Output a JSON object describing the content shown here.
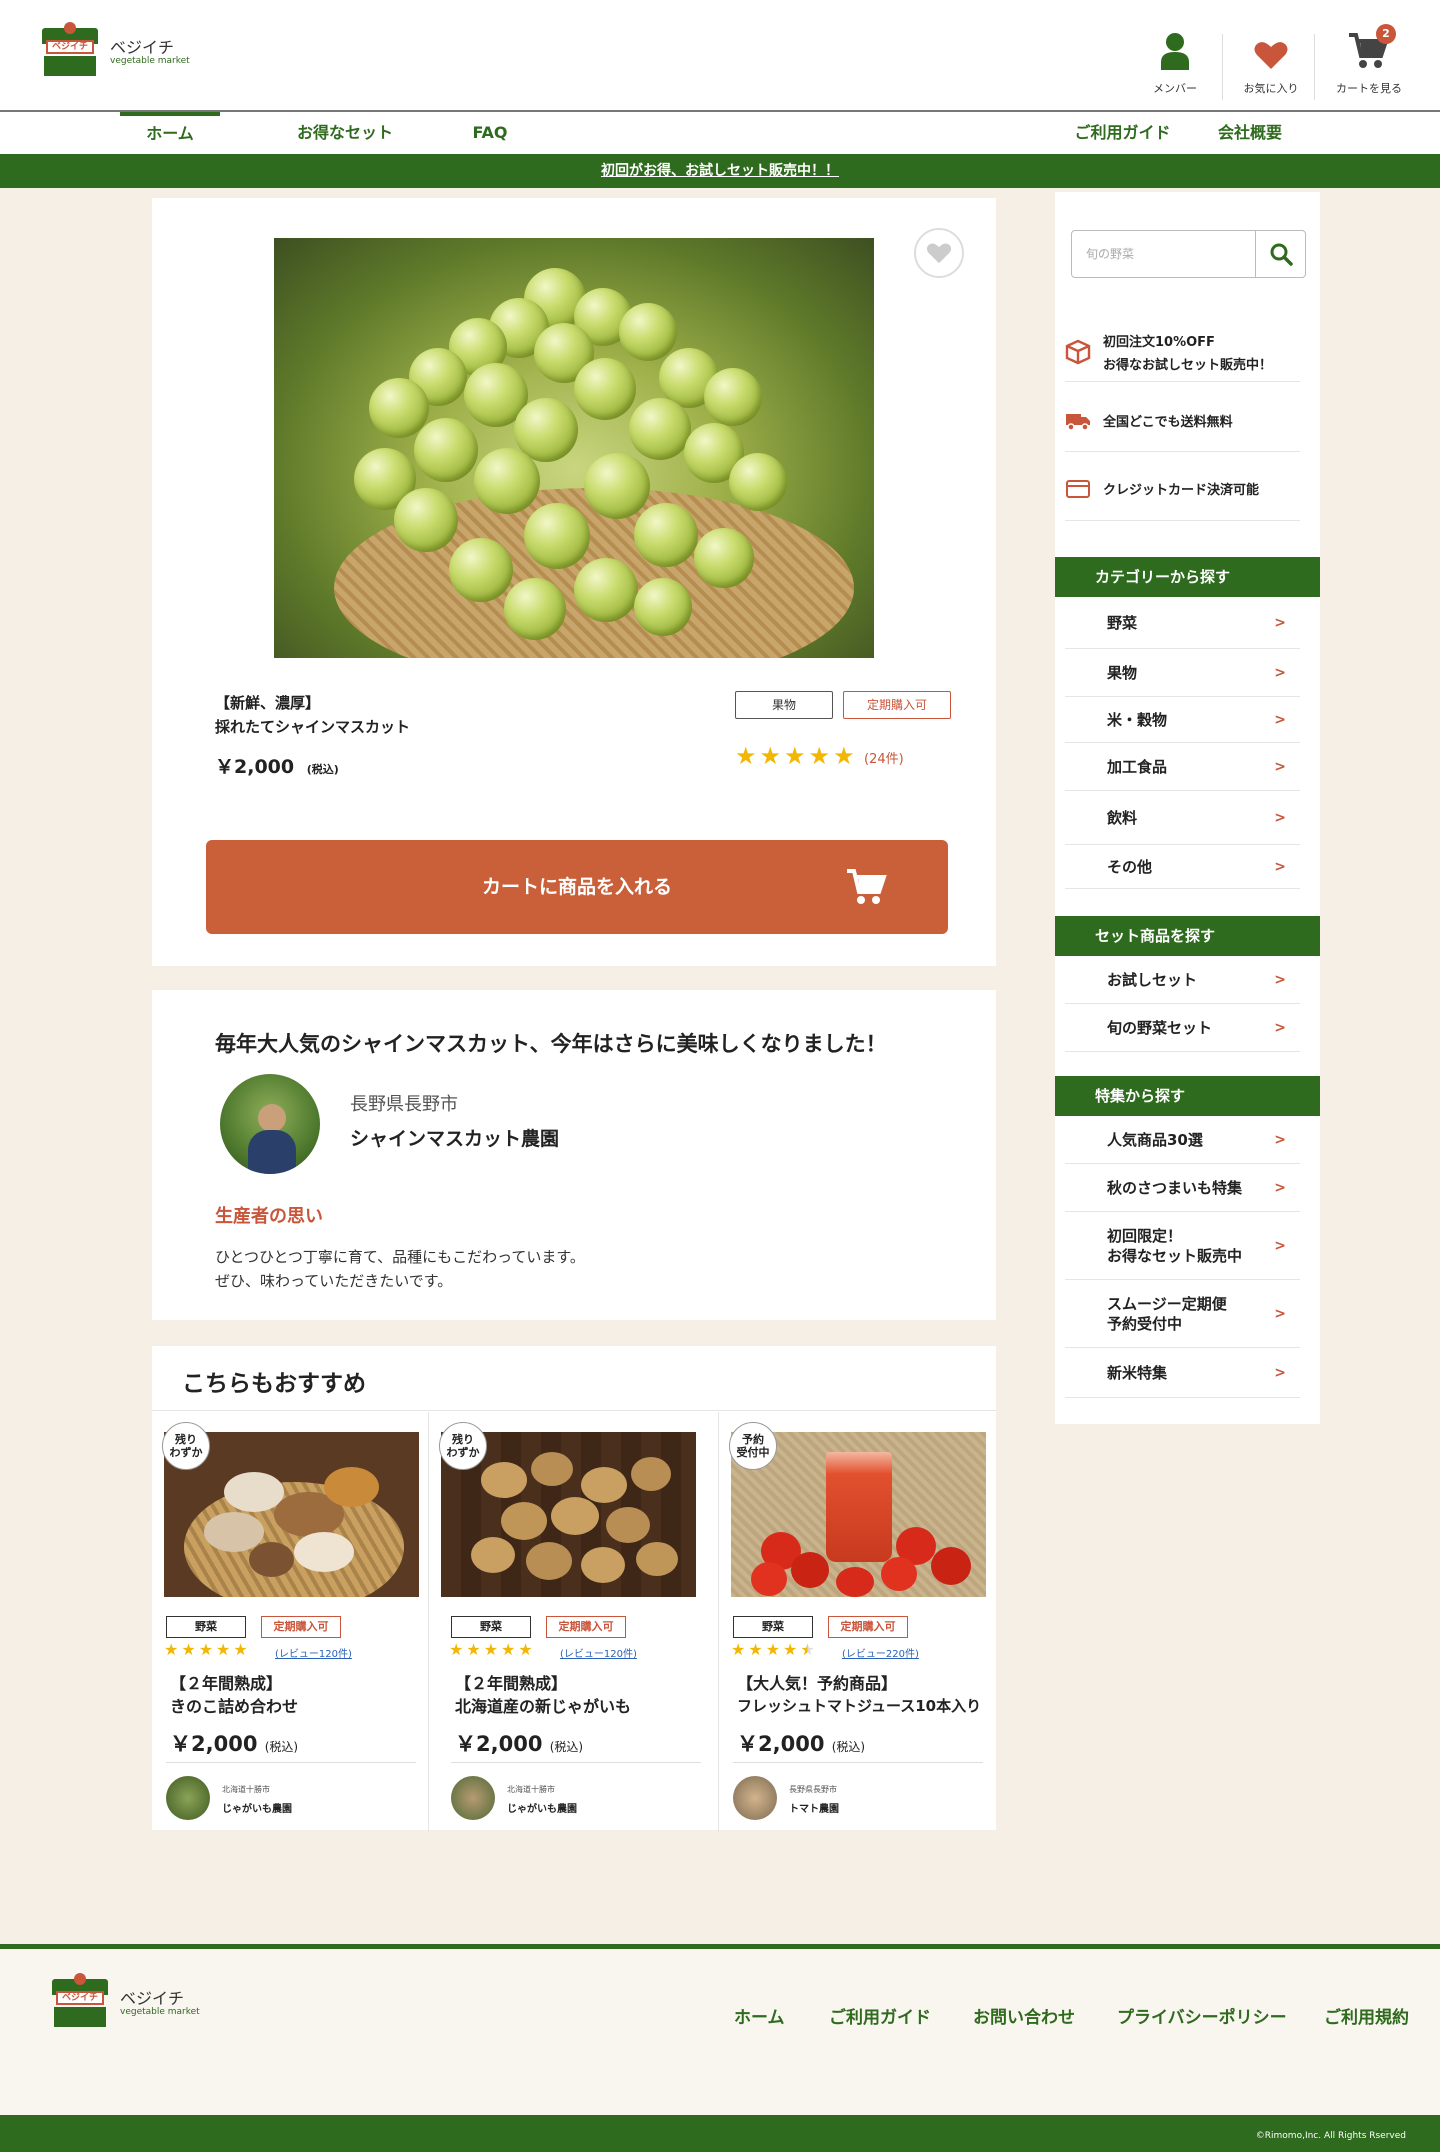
{
  "brand": {
    "name": "ベジイチ",
    "sub": "vegetable market",
    "sign": "ベジイチ"
  },
  "header": {
    "member": "メンバー",
    "favorite": "お気に入り",
    "cart": "カートを見る",
    "cart_count": "2"
  },
  "nav": {
    "items": [
      "ホーム",
      "お得なセット",
      "FAQ"
    ],
    "right": [
      "ご利用ガイド",
      "会社概要"
    ]
  },
  "banner": "初回がお得、お試しセット販売中！！",
  "product": {
    "title_line1": "【新鮮、濃厚】",
    "title_line2": "採れたてシャインマスカット",
    "price": "￥2,000",
    "tax": "(税込)",
    "tag1": "果物",
    "tag2": "定期購入可",
    "rating": 5,
    "review_count": "(24件)",
    "cart_button": "カートに商品を入れる"
  },
  "producer": {
    "heading": "毎年大人気のシャインマスカット、今年はさらに美味しくなりました！",
    "location": "長野県長野市",
    "farm": "シャインマスカット農園",
    "thought_title": "生産者の思い",
    "thought_line1": "ひとつひとつ丁寧に育て、品種にもこだわっています。",
    "thought_line2": "ぜひ、味わっていただきたいです。"
  },
  "recommend": {
    "heading": "こちらもおすすめ",
    "items": [
      {
        "badge1": "残り",
        "badge2": "わずか",
        "tag1": "野菜",
        "tag2": "定期購入可",
        "review": "(レビュー120件)",
        "rating": 5,
        "title1": "【２年間熟成】",
        "title2": "きのこ詰め合わせ",
        "price": "￥2,000",
        "tax": "(税込)",
        "loc": "北海道十勝市",
        "farm": "じゃがいも農園"
      },
      {
        "badge1": "残り",
        "badge2": "わずか",
        "tag1": "野菜",
        "tag2": "定期購入可",
        "review": "(レビュー120件)",
        "rating": 5,
        "title1": "【２年間熟成】",
        "title2": "北海道産の新じゃがいも",
        "price": "￥2,000",
        "tax": "(税込)",
        "loc": "北海道十勝市",
        "farm": "じゃがいも農園"
      },
      {
        "badge1": "予約",
        "badge2": "受付中",
        "tag1": "野菜",
        "tag2": "定期購入可",
        "review": "(レビュー220件)",
        "rating": 4.5,
        "title1": "【大人気！予約商品】",
        "title2": "フレッシュトマトジュース10本入り",
        "price": "￥2,000",
        "tax": "(税込)",
        "loc": "長野県長野市",
        "farm": "トマト農園"
      }
    ]
  },
  "sidebar": {
    "search_placeholder": "旬の野菜",
    "features": [
      {
        "line1": "初回注文10%OFF",
        "line2": "お得なお試しセット販売中！"
      },
      {
        "line1": "全国どこでも送料無料",
        "line2": ""
      },
      {
        "line1": "クレジットカード決済可能",
        "line2": ""
      }
    ],
    "category_header": "カテゴリーから探す",
    "categories": [
      "野菜",
      "果物",
      "米・穀物",
      "加工食品",
      "飲料",
      "その他"
    ],
    "set_header": "セット商品を探す",
    "sets": [
      "お試しセット",
      "旬の野菜セット"
    ],
    "special_header": "特集から探す",
    "specials": [
      {
        "line1": "人気商品30選",
        "line2": ""
      },
      {
        "line1": "秋のさつまいも特集",
        "line2": ""
      },
      {
        "line1": "初回限定！",
        "line2": "お得なセット販売中"
      },
      {
        "line1": "スムージー定期便",
        "line2": "予約受付中"
      },
      {
        "line1": "新米特集",
        "line2": ""
      }
    ]
  },
  "footer": {
    "links": [
      "ホーム",
      "ご利用ガイド",
      "お問い合わせ",
      "プライバシーポリシー",
      "ご利用規約"
    ],
    "copyright": "©Rimomo,Inc. All Rights Rserved"
  },
  "colors": {
    "green": "#2f6b1e",
    "orange": "#c9553a",
    "cart_button": "#c9603a",
    "background": "#f6efe5"
  }
}
